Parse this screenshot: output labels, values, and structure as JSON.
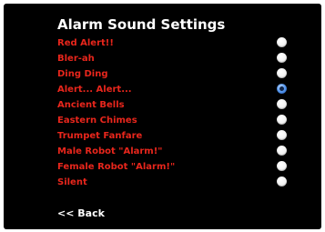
{
  "title": "Alarm Sound Settings",
  "options": [
    {
      "label": "Red Alert!!",
      "selected": false
    },
    {
      "label": "Bler-ah",
      "selected": false
    },
    {
      "label": "Ding Ding",
      "selected": false
    },
    {
      "label": "Alert... Alert...",
      "selected": true
    },
    {
      "label": "Ancient Bells",
      "selected": false
    },
    {
      "label": "Eastern Chimes",
      "selected": false
    },
    {
      "label": "Trumpet Fanfare",
      "selected": false
    },
    {
      "label": "Male Robot \"Alarm!\"",
      "selected": false
    },
    {
      "label": "Female Robot \"Alarm!\"",
      "selected": false
    },
    {
      "label": "Silent",
      "selected": false
    }
  ],
  "back_label": "<< Back",
  "colors": {
    "background": "#000000",
    "title": "#ffffff",
    "option_text": "#e8261c",
    "radio_selected": "#2f7de1"
  }
}
